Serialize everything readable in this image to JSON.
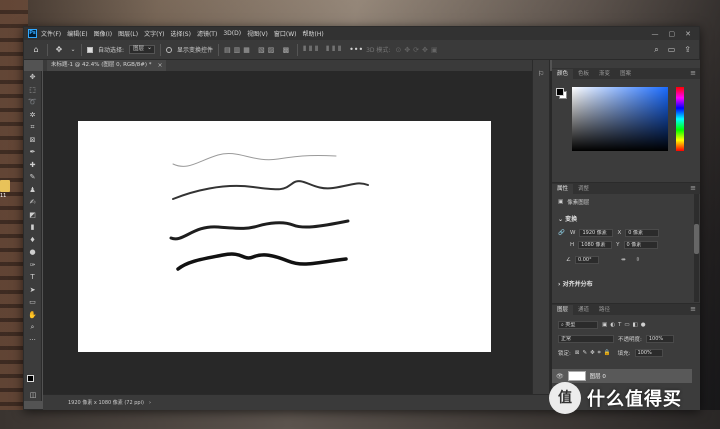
{
  "menubar": {
    "app_icon": "Ps",
    "items": [
      "文件(F)",
      "编辑(E)",
      "图像(I)",
      "图层(L)",
      "文字(Y)",
      "选择(S)",
      "滤镜(T)",
      "3D(D)",
      "视图(V)",
      "窗口(W)",
      "帮助(H)"
    ]
  },
  "options": {
    "auto_select_label": "自动选择:",
    "auto_select_value": "图层",
    "show_transform_label": "显示变换控件",
    "mode_3d": "3D 模式:"
  },
  "document": {
    "tab_title": "未标题-1 @ 42.4% (图层 0, RGB/8#) *",
    "status": "1920 像素 x 1080 像素 (72 ppi)"
  },
  "panels": {
    "color_tabs": [
      "颜色",
      "色板",
      "渐变",
      "图案"
    ],
    "props_tabs": [
      "属性",
      "调整"
    ],
    "pixel_layer_label": "像素图层",
    "transform_label": "变换",
    "w_label": "W",
    "w_value": "1920 像素",
    "h_label": "H",
    "h_value": "1080 像素",
    "x_label": "X",
    "x_value": "0 像素",
    "y_label": "Y",
    "y_value": "0 像素",
    "angle_value": "0.00°",
    "align_label": "对齐并分布",
    "layers_tabs": [
      "图层",
      "通道",
      "路径"
    ],
    "kind_filter": "类型",
    "blend_mode": "正常",
    "opacity_label": "不透明度:",
    "opacity_value": "100%",
    "lock_label": "锁定:",
    "fill_label": "填充:",
    "fill_value": "100%",
    "layer_name": "图层 0"
  },
  "watermark": {
    "logo": "值",
    "text": "什么值得买"
  },
  "desktop": {
    "icon_label": "11"
  },
  "colors": {
    "foreground": "#000000",
    "background": "#ffffff",
    "accent": "#31a8ff"
  }
}
